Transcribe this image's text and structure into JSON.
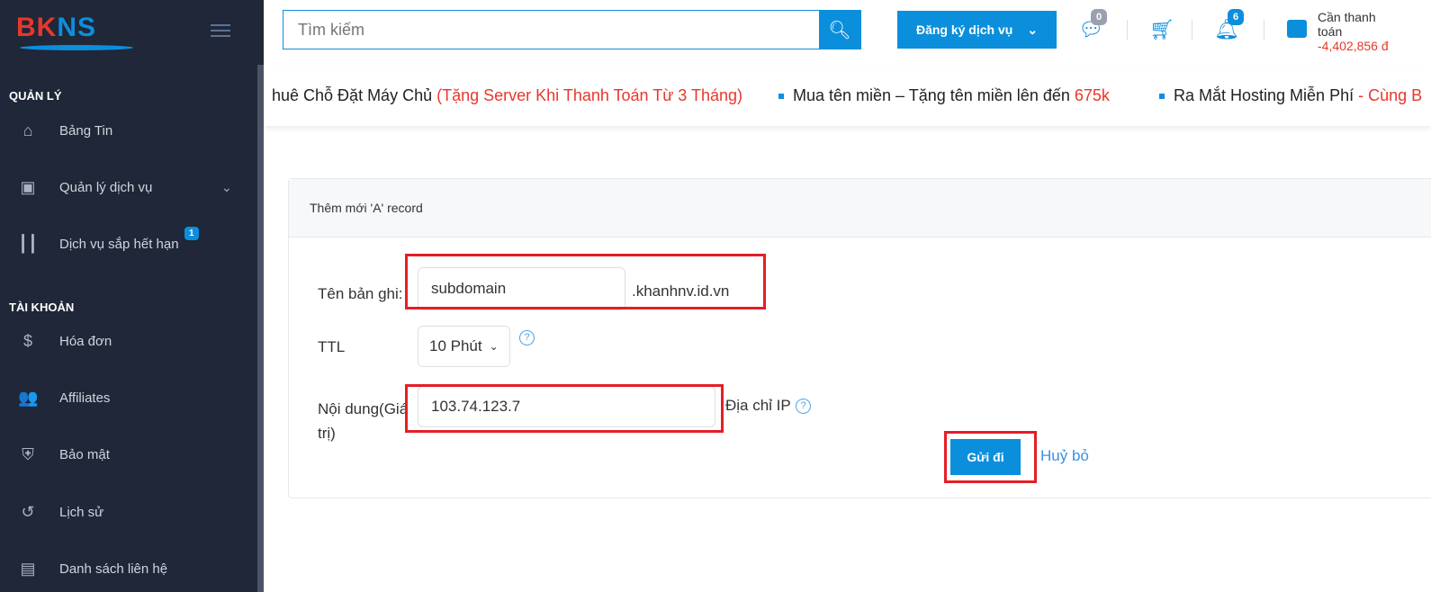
{
  "logo": {
    "part1": "BK",
    "part2": "NS"
  },
  "sidebar": {
    "sections": [
      {
        "label": "QUẢN LÝ"
      },
      {
        "label": "TÀI KHOẢN"
      }
    ],
    "items": [
      {
        "label": "Bảng Tin",
        "icon": "home-icon"
      },
      {
        "label": "Quản lý dịch vụ",
        "icon": "id-card-icon"
      },
      {
        "label": "Dịch vụ sắp hết hạn",
        "icon": "bar-chart-icon",
        "badge": "1"
      },
      {
        "label": "Hóa đơn",
        "icon": "dollar-icon"
      },
      {
        "label": "Affiliates",
        "icon": "user-plus-icon"
      },
      {
        "label": "Bảo mật",
        "icon": "shield-icon"
      },
      {
        "label": "Lịch sử",
        "icon": "history-icon"
      },
      {
        "label": "Danh sách liên hệ",
        "icon": "contacts-icon"
      }
    ]
  },
  "header": {
    "search_placeholder": "Tìm kiếm",
    "register_label": "Đăng ký dịch vụ",
    "tickets_badge": "0",
    "notifications_badge": "6",
    "payment_label": "Cần thanh toán",
    "payment_amount": "-4,402,856 đ"
  },
  "ticker": [
    {
      "text": "huê Chỗ Đặt Máy Chủ ",
      "highlight": "(Tặng Server Khi Thanh Toán Từ 3 Tháng)"
    },
    {
      "text": "Mua tên miền – Tặng tên miền lên đến ",
      "highlight": "675k"
    },
    {
      "text": "Ra Mắt Hosting Miễn Phí ",
      "highlight": "- Cùng B"
    }
  ],
  "form": {
    "title": "Thêm mới 'A' record",
    "name_label": "Tên bản ghi:",
    "name_value": "subdomain",
    "domain_suffix": ".khanhnv.id.vn",
    "ttl_label": "TTL",
    "ttl_value": "10 Phút",
    "content_label": "Nội dung(Giá trị)",
    "content_value": "103.74.123.7",
    "content_hint": "Địa chỉ IP",
    "submit_label": "Gửi đi",
    "cancel_label": "Huỷ bỏ"
  },
  "colors": {
    "primary": "#0b8fdc",
    "sidebar": "#1f2738",
    "danger": "#e8372a",
    "highlight": "#e41e26"
  }
}
